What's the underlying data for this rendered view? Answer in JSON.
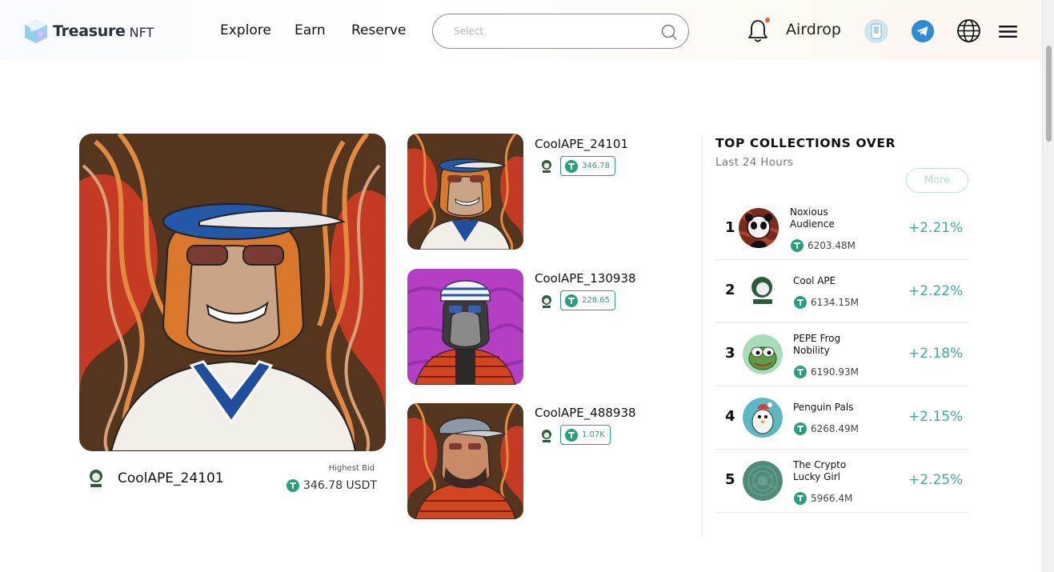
{
  "header": {
    "logo": {
      "name": "Treasure",
      "suffix": "NFT"
    },
    "nav": [
      {
        "label": "Explore"
      },
      {
        "label": "Earn"
      },
      {
        "label": "Reserve"
      }
    ],
    "search": {
      "placeholder": "Select",
      "value": ""
    },
    "airdrop_label": "Airdrop",
    "icons": [
      "search-icon",
      "bell-icon",
      "wallet-icon",
      "telegram-icon",
      "globe-icon",
      "menu-icon"
    ]
  },
  "featured": {
    "owner": "CoolAPE_24101",
    "highest_bid_label": "Highest Bid",
    "highest_bid": "346.78 USDT"
  },
  "thumbnails": [
    {
      "name": "CoolAPE_24101",
      "price": "346.78"
    },
    {
      "name": "CoolAPE_130938",
      "price": "228.65"
    },
    {
      "name": "CoolAPE_488938",
      "price": "1.07K"
    }
  ],
  "top_collections": {
    "title": "TOP COLLECTIONS OVER",
    "subtitle": "Last 24 Hours",
    "more_label": "More",
    "items": [
      {
        "rank": "1",
        "name": "Noxious Audience",
        "volume": "6203.48M",
        "change": "+2.21%"
      },
      {
        "rank": "2",
        "name": "Cool APE",
        "volume": "6134.15M",
        "change": "+2.22%"
      },
      {
        "rank": "3",
        "name": "PEPE Frog Nobility",
        "volume": "6190.93M",
        "change": "+2.18%"
      },
      {
        "rank": "4",
        "name": "Penguin Pals",
        "volume": "6268.49M",
        "change": "+2.15%"
      },
      {
        "rank": "5",
        "name": "The Crypto Lucky Girl",
        "volume": "5966.4M",
        "change": "+2.25%"
      }
    ]
  },
  "colors": {
    "accent": "#26a17b",
    "change": "#3aae96",
    "telegram": "#2f8bd6"
  }
}
